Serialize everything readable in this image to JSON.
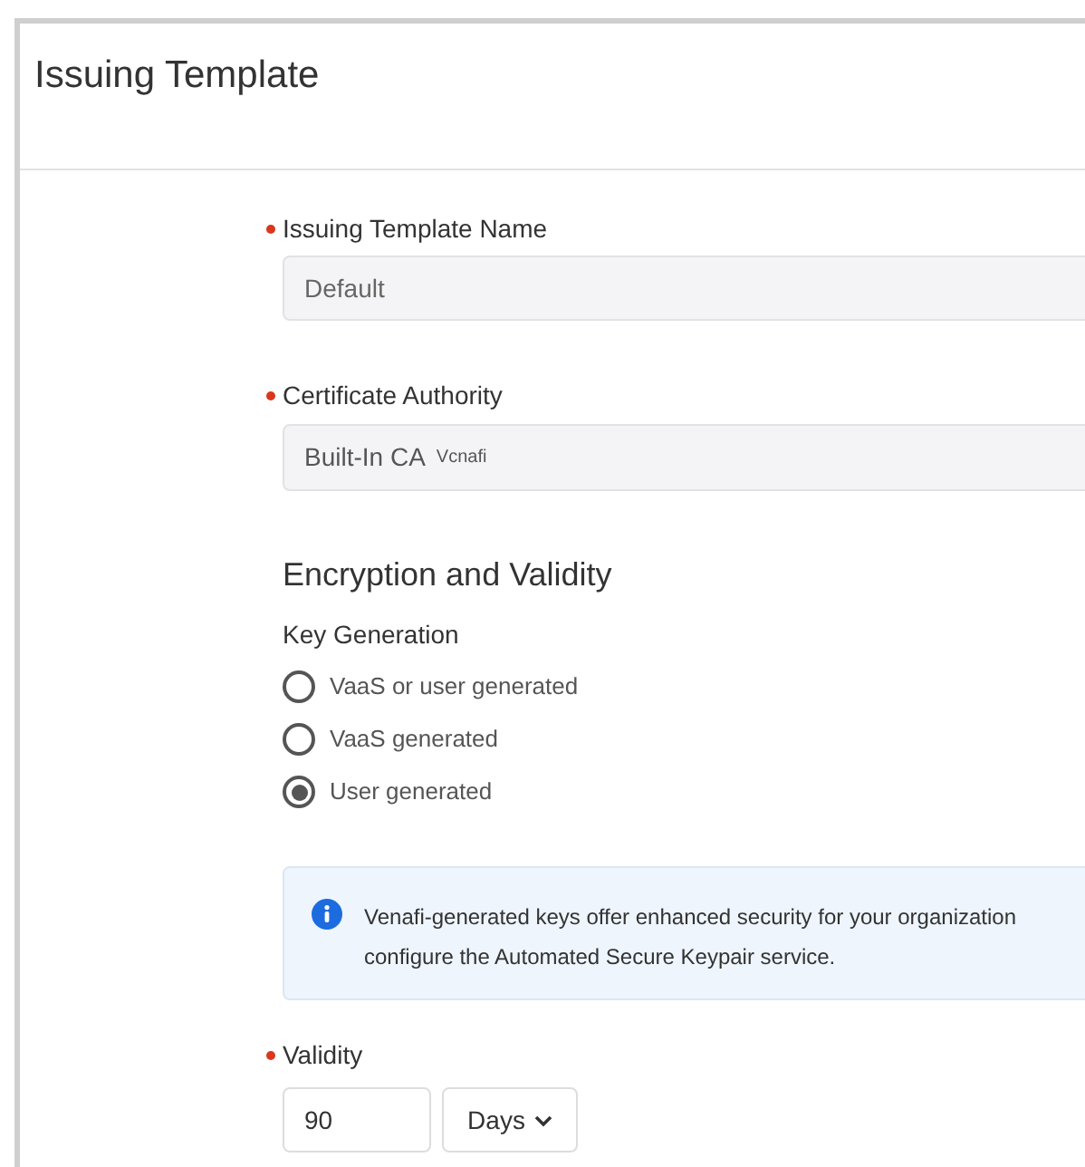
{
  "title": "Issuing Template",
  "name_field": {
    "label": "Issuing Template Name",
    "required": true,
    "value": "Default"
  },
  "ca_field": {
    "label": "Certificate Authority",
    "required": true,
    "value": "Built-In CA",
    "tag": "Vcnafi"
  },
  "section": {
    "title": "Encryption and Validity"
  },
  "key_generation": {
    "label": "Key Generation",
    "options": [
      {
        "label": "VaaS or user generated",
        "selected": false
      },
      {
        "label": "VaaS generated",
        "selected": false
      },
      {
        "label": "User generated",
        "selected": true
      }
    ]
  },
  "info": {
    "lines": [
      "Venafi-generated keys offer enhanced security for your organization",
      "configure the Automated Secure Keypair service."
    ]
  },
  "validity": {
    "label": "Validity",
    "required": true,
    "value": "90",
    "unit": "Days"
  }
}
